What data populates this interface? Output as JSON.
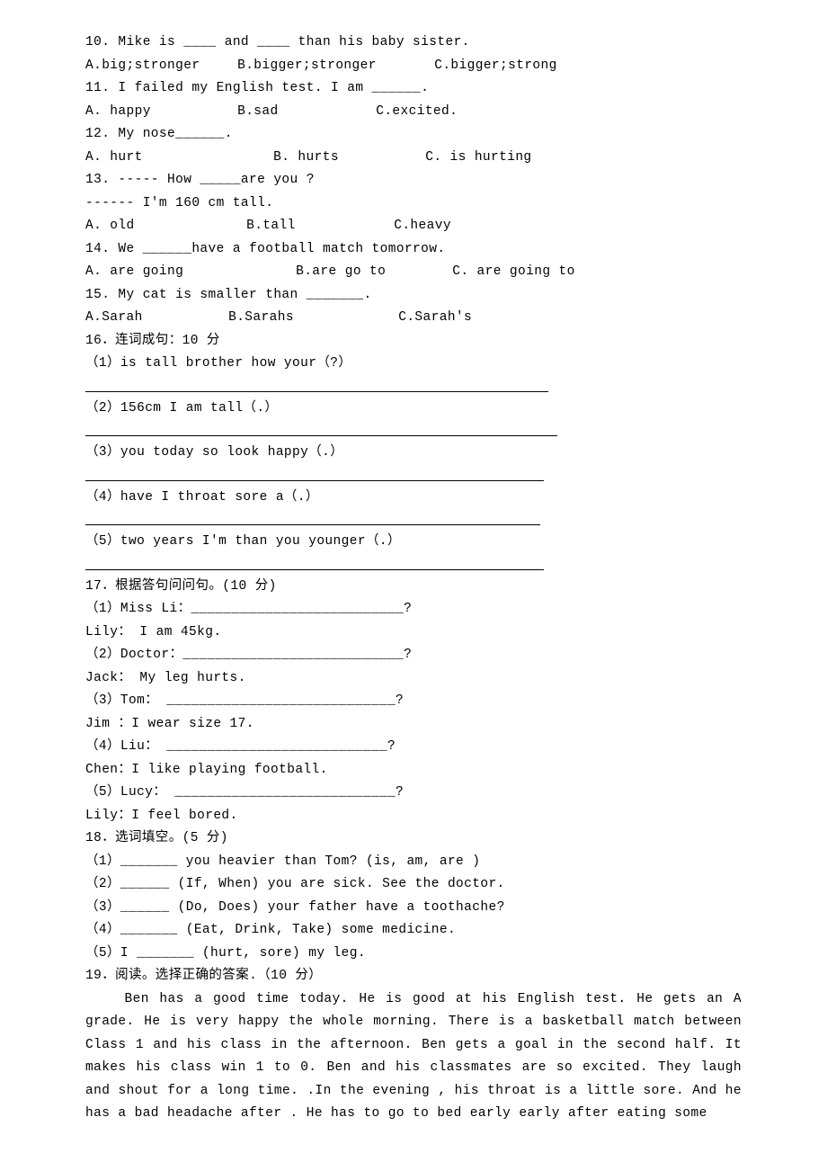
{
  "q10": {
    "stem": "10. Mike is ____ and ____ than his baby sister.",
    "optA": "A.big;stronger",
    "optB": "B.bigger;stronger",
    "optC": "C.bigger;strong"
  },
  "q11": {
    "stem": "11. I failed my English test. I am ______.",
    "optA": "A. happy",
    "optB": "B.sad",
    "optC": "C.excited."
  },
  "q12": {
    "stem": "12. My nose______.",
    "optA": "A. hurt",
    "optB": "B. hurts",
    "optC": "C. is hurting"
  },
  "q13": {
    "stem": "13. ----- How _____are you ?",
    "stem2": "------ I'm 160 cm tall.",
    "optA": "A. old",
    "optB": "B.tall",
    "optC": "C.heavy"
  },
  "q14": {
    "stem": "14. We ______have a football match tomorrow.",
    "optA": "A. are going",
    "optB": "B.are go to",
    "optC": "C. are going to"
  },
  "q15": {
    "stem": "15. My cat is smaller than _______.",
    "optA": "A.Sarah",
    "optB": "B.Sarahs",
    "optC": "C.Sarah's"
  },
  "q16": {
    "head": "16．连词成句：10 分",
    "i1": "（1）is  tall   brother  how   your（?）",
    "i2": "（2）156cm  I  am   tall（.）",
    "i3": "（3）you   today so look happy（.）",
    "i4": "（4）have   I   throat  sore   a（.）",
    "i5": "（5）two years   I'm   than   you   younger（.）"
  },
  "q17": {
    "head": "17．根据答句问问句。(10 分)",
    "p1a": "（1）Miss Li：__________________________?",
    "p1b": "Lily：  I am 45kg.",
    "p2a": "（2）Doctor：___________________________?",
    "p2b": "Jack：  My leg hurts.",
    "p3a": "（3）Tom：   ____________________________?",
    "p3b": "Jim ：I wear size 17.",
    "p4a": "（4）Liu：  ___________________________?",
    "p4b": "Chen：I like playing football.",
    "p5a": "（5）Lucy：  ___________________________?",
    "p5b": "Lily：I feel bored."
  },
  "q18": {
    "head": "18．选词填空。(5 分)",
    "i1": "（1）_______ you heavier than Tom? (is, am, are )",
    "i2": "（2）______ (If, When) you are sick. See the doctor.",
    "i3": "（3）______ (Do, Does) your father have a toothache?",
    "i4": "（4）_______ (Eat, Drink, Take) some medicine.",
    "i5": "（5）I _______ (hurt, sore) my leg."
  },
  "q19": {
    "head": "19．阅读。选择正确的答案.（10 分）",
    "para": "Ben has a good time today. He is good at his English test. He gets an A grade. He is very happy the whole morning. There is a basketball match between Class 1 and his class in the afternoon. Ben gets a goal in the second half. It makes his class win 1 to 0. Ben and his classmates are so excited. They laugh and shout for a long time. .In the evening , his throat is a little sore. And he has a bad headache after . He has to go to bed early early after eating some"
  }
}
